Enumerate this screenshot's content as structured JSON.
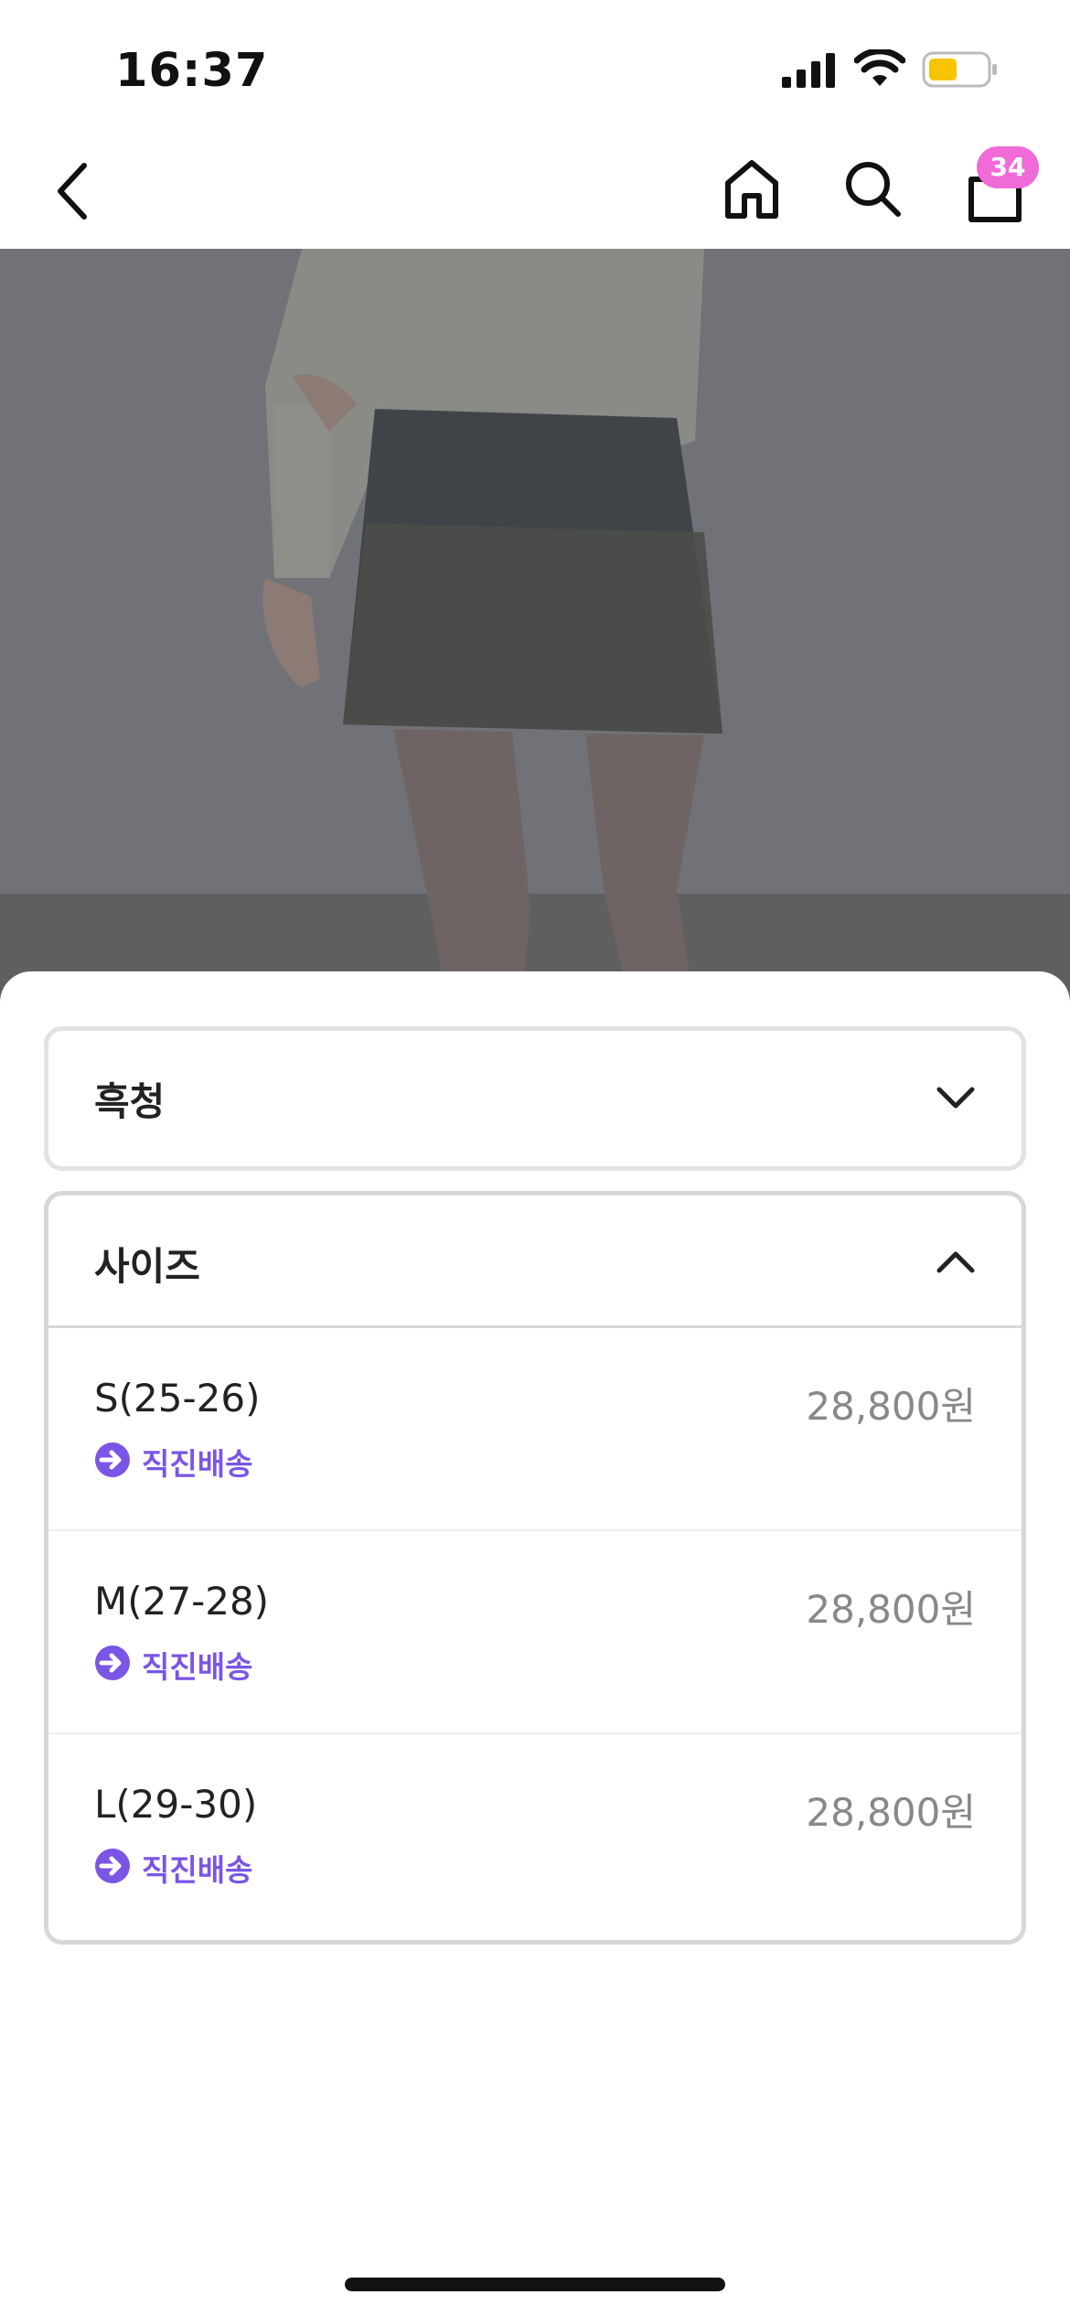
{
  "status_bar": {
    "time": "16:37",
    "icons": [
      "signal-icon",
      "wifi-icon",
      "battery-icon"
    ],
    "battery_color": "#f7c400"
  },
  "nav": {
    "icons": [
      "back-icon",
      "home-icon",
      "search-icon",
      "bag-icon"
    ],
    "cart_count": "34",
    "badge_color": "#f06ad8"
  },
  "product_image": {
    "icon": "product-photo",
    "overlay": "dimmed"
  },
  "options": {
    "color": {
      "label": "흑청",
      "state": "collapsed"
    },
    "size": {
      "label": "사이즈",
      "state": "expanded",
      "items": [
        {
          "name": "S(25-26)",
          "price": "28,800원",
          "delivery": "직진배송"
        },
        {
          "name": "M(27-28)",
          "price": "28,800원",
          "delivery": "직진배송"
        },
        {
          "name": "L(29-30)",
          "price": "28,800원",
          "delivery": "직진배송"
        }
      ]
    },
    "accent_color": "#7a55e6"
  }
}
